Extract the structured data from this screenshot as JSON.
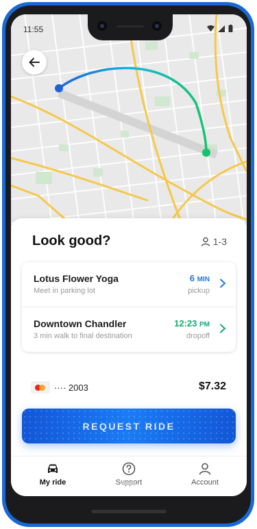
{
  "status_bar": {
    "time": "11:55"
  },
  "map": {
    "route_start_color": "#1e63d6",
    "route_end_color": "#14c46b"
  },
  "sheet": {
    "title": "Look good?",
    "passengers": "1-3"
  },
  "trip": {
    "pickup": {
      "place": "Lotus Flower Yoga",
      "note": "Meet in parking lot",
      "eta_value": "6",
      "eta_unit": "MIN",
      "eta_label": "pickup"
    },
    "dropoff": {
      "place": "Downtown Chandler",
      "note": "3 min walk to final destination",
      "eta_value": "12:23",
      "eta_unit": "PM",
      "eta_label": "dropoff"
    }
  },
  "payment": {
    "card_masked": "···· 2003",
    "price": "$7.32"
  },
  "request_button": {
    "label": "REQUEST RIDE"
  },
  "nav": {
    "items": [
      {
        "label": "My ride",
        "icon": "car-icon",
        "active": true
      },
      {
        "label": "Support",
        "icon": "help-icon",
        "active": false
      },
      {
        "label": "Account",
        "icon": "person-icon",
        "active": false
      }
    ]
  },
  "colors": {
    "accent_blue": "#1f78e0",
    "accent_green": "#14a874",
    "phone_frame": "#1769d6"
  }
}
